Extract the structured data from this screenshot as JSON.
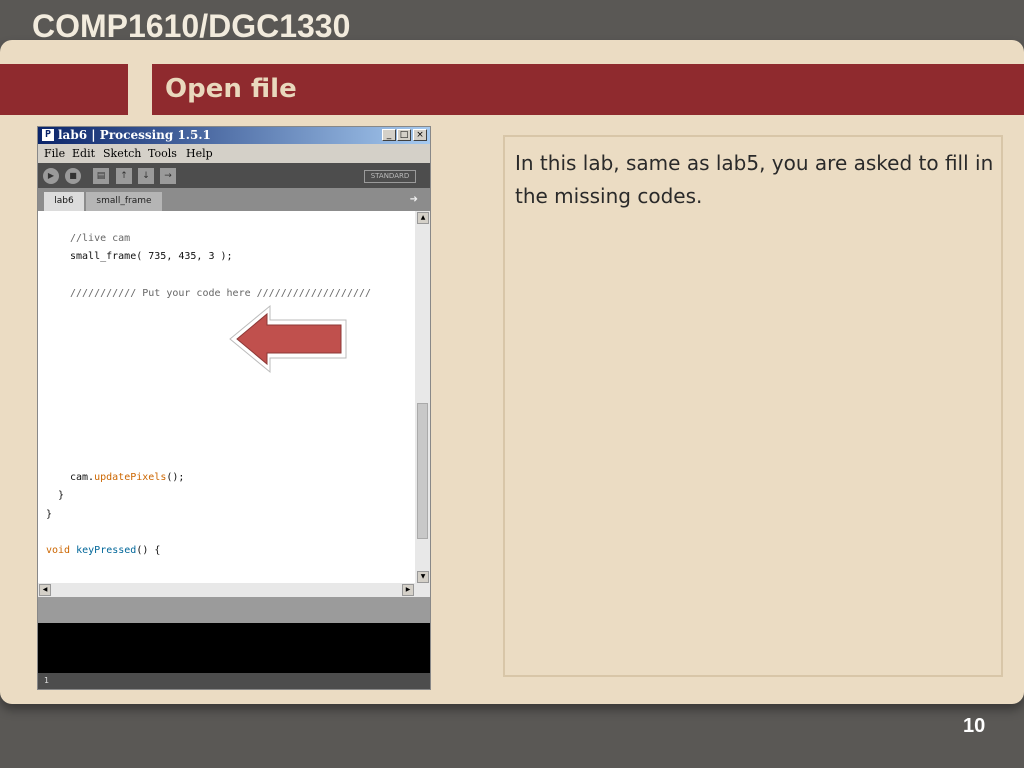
{
  "header": {
    "course": "COMP1610/DGC1330",
    "slide_title": "Open file",
    "page_number": "10"
  },
  "body_text": "In this lab, same as lab5, you are asked to fill in the missing codes.",
  "window": {
    "title": "lab6 | Processing 1.5.1",
    "menu": [
      "File",
      "Edit",
      "Sketch",
      "Tools",
      "Help"
    ],
    "mode": "STANDARD",
    "tabs": [
      "lab6",
      "small_frame"
    ],
    "line_number": "1",
    "code": {
      "c1": "//live cam",
      "c2": "small_frame( 735, 435, 3 );",
      "c3": "/////////// Put your code here ///////////////////",
      "c4a": "cam.",
      "c4b": "updatePixels",
      "c4c": "();",
      "c5": "}",
      "c6": "}",
      "c7a": "void",
      "c7b": "keyPressed",
      "c7c": "() {"
    }
  },
  "colors": {
    "accent": "#8f2a2e",
    "slide_bg": "#ebdcc3",
    "page_bg": "#5a5855"
  }
}
